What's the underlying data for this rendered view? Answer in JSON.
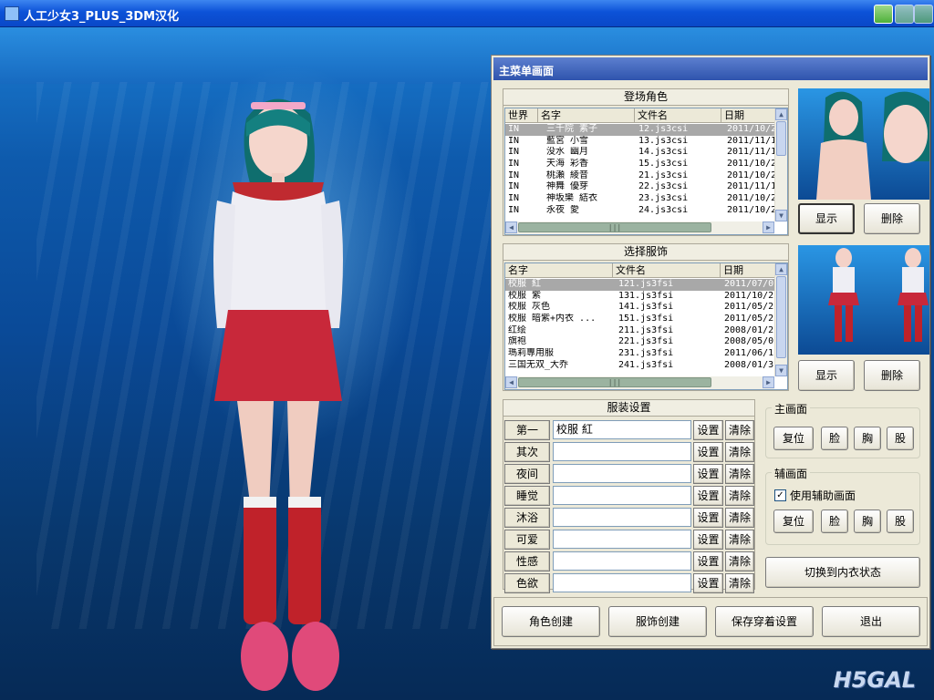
{
  "window": {
    "title": "人工少女3_PLUS_3DM汉化"
  },
  "menu": {
    "title": "主菜单画面"
  },
  "characters": {
    "heading": "登场角色",
    "columns": [
      "世界",
      "名字",
      "文件名",
      "日期"
    ],
    "rows": [
      [
        "IN",
        "三千院 素子",
        "12.js3csi",
        "2011/10/2"
      ],
      [
        "IN",
        "藍宮 小雪",
        "13.js3csi",
        "2011/11/1"
      ],
      [
        "IN",
        "没水 幽月",
        "14.js3csi",
        "2011/11/1"
      ],
      [
        "IN",
        "天海 彩香",
        "15.js3csi",
        "2011/10/2"
      ],
      [
        "IN",
        "桃瀬 綾音",
        "21.js3csi",
        "2011/10/2"
      ],
      [
        "IN",
        "神舞 優芽",
        "22.js3csi",
        "2011/11/1"
      ],
      [
        "IN",
        "神坂樂 結衣",
        "23.js3csi",
        "2011/10/2"
      ],
      [
        "IN",
        "永夜 愛",
        "24.js3csi",
        "2011/10/2"
      ]
    ],
    "selected_index": 0,
    "show_button": "显示",
    "delete_button": "删除"
  },
  "outfits": {
    "heading": "选择服饰",
    "columns": [
      "名字",
      "文件名",
      "日期"
    ],
    "rows": [
      [
        "校服 紅",
        "121.js3fsi",
        "2011/07/0"
      ],
      [
        "校服 紫",
        "131.js3fsi",
        "2011/10/2"
      ],
      [
        "校服 灰色",
        "141.js3fsi",
        "2011/05/2"
      ],
      [
        "校服 暗紫+内衣 ...",
        "151.js3fsi",
        "2011/05/2"
      ],
      [
        "红绘",
        "211.js3fsi",
        "2008/01/2"
      ],
      [
        "旗袍",
        "221.js3fsi",
        "2008/05/0"
      ],
      [
        "瑪莉專用服",
        "231.js3fsi",
        "2011/06/1"
      ],
      [
        "三国无双_大乔",
        "241.js3fsi",
        "2008/01/3"
      ]
    ],
    "selected_index": 0,
    "show_button": "显示",
    "delete_button": "删除"
  },
  "costume_settings": {
    "heading": "服装设置",
    "set_label": "设置",
    "clear_label": "清除",
    "slots": [
      {
        "label": "第一",
        "value": "校服 紅"
      },
      {
        "label": "其次",
        "value": ""
      },
      {
        "label": "夜间",
        "value": ""
      },
      {
        "label": "睡觉",
        "value": ""
      },
      {
        "label": "沐浴",
        "value": ""
      },
      {
        "label": "可爱",
        "value": ""
      },
      {
        "label": "性感",
        "value": ""
      },
      {
        "label": "色欲",
        "value": ""
      }
    ]
  },
  "main_view": {
    "title": "主画面",
    "buttons": [
      "复位",
      "脸",
      "胸",
      "股"
    ]
  },
  "sub_view": {
    "title": "辅画面",
    "checkbox_label": "使用辅助画面",
    "checked": true,
    "buttons": [
      "复位",
      "脸",
      "胸",
      "股"
    ]
  },
  "underwear_toggle": "切换到内衣状态",
  "bottom_buttons": [
    "角色创建",
    "服饰创建",
    "保存穿着设置",
    "退出"
  ],
  "watermark": "H5GAL",
  "colors": {
    "titlebar": "#0c52d8",
    "panel": "#ece9d8",
    "selection": "#a8a8a8"
  }
}
